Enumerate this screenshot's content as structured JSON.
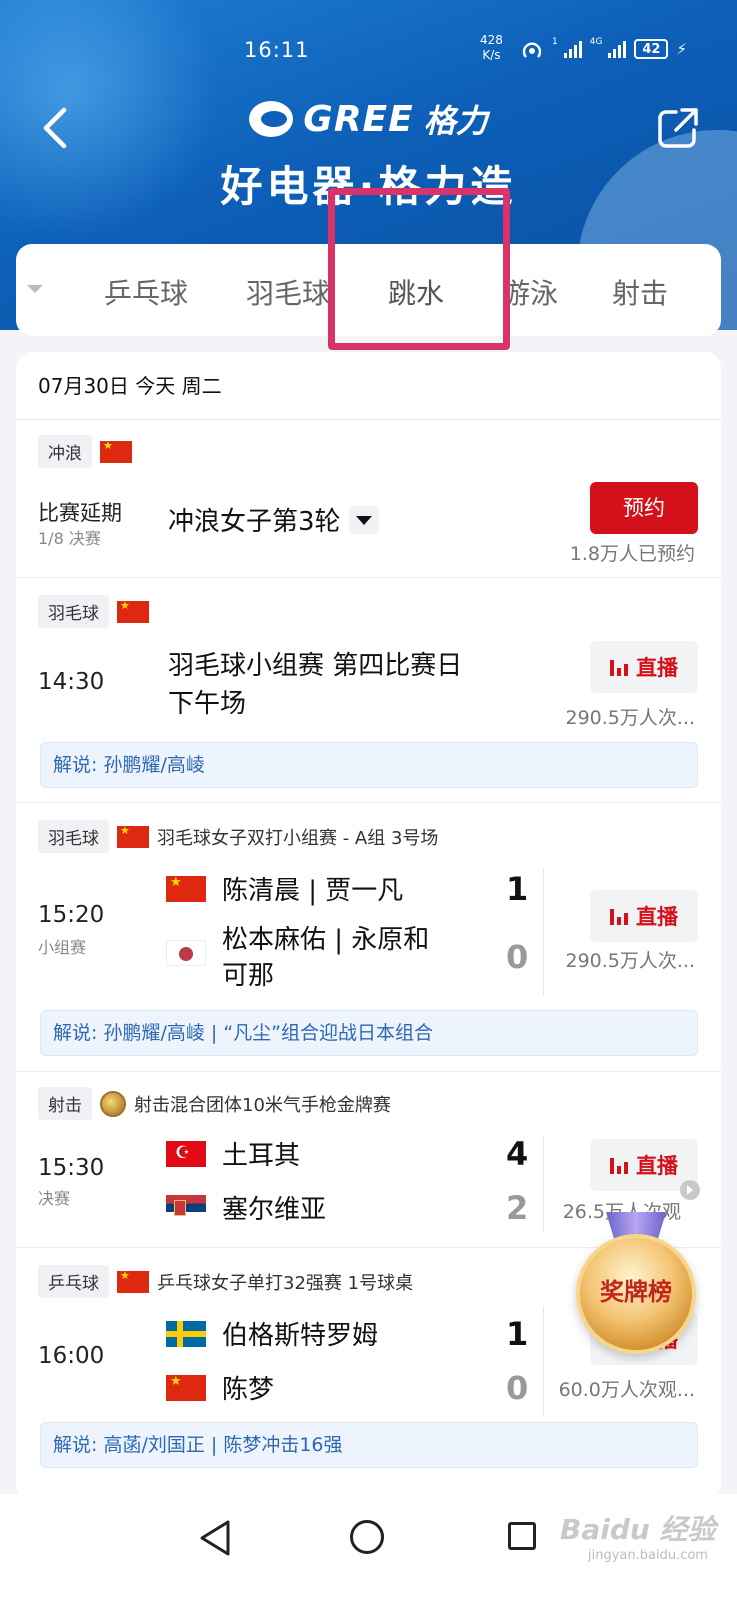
{
  "status_bar": {
    "time": "16:11",
    "speed_value": "428",
    "speed_unit": "K/s",
    "battery": "42"
  },
  "header": {
    "brand": "GREE",
    "brand_cn": "格力",
    "slogan": "好电器·格力造"
  },
  "tabs": [
    {
      "label": "乒乓球"
    },
    {
      "label": "羽毛球"
    },
    {
      "label": "跳水",
      "active": true
    },
    {
      "label": "游泳"
    },
    {
      "label": "射击"
    }
  ],
  "schedule": {
    "date": "07月30日 今天 周二",
    "events": [
      {
        "sport": "冲浪",
        "status": "比赛延期",
        "round": "1/8 决赛",
        "title": "冲浪女子第3轮",
        "button": "预约",
        "count": "1.8万人已预约"
      },
      {
        "sport": "羽毛球",
        "time": "14:30",
        "title_line1": "羽毛球小组赛 第四比赛日",
        "title_line2": "下午场",
        "button": "直播",
        "count": "290.5万人次...",
        "commentary": "解说: 孙鹏耀/高崚"
      },
      {
        "sport": "羽毛球",
        "event_name": "羽毛球女子双打小组赛 - A组 3号场",
        "time": "15:20",
        "stage": "小组赛",
        "team1": "陈清晨 | 贾一凡",
        "score1": "1",
        "team2_line1": "松本麻佑 | 永原和",
        "team2_line2": "可那",
        "score2": "0",
        "button": "直播",
        "count": "290.5万人次...",
        "commentary": "解说: 孙鹏耀/高崚 | “凡尘”组合迎战日本组合"
      },
      {
        "sport": "射击",
        "event_name": "射击混合团体10米气手枪金牌赛",
        "time": "15:30",
        "stage": "决赛",
        "team1": "土耳其",
        "score1": "4",
        "team2": "塞尔维亚",
        "score2": "2",
        "button": "直播",
        "count": "26.5万人次观"
      },
      {
        "sport": "乒乓球",
        "event_name": "乒乓球女子单打32强赛 1号球桌",
        "time": "16:00",
        "team1": "伯格斯特罗姆",
        "score1": "1",
        "team2": "陈梦",
        "score2": "0",
        "button": "直播",
        "count": "60.0万人次观...",
        "commentary": "解说: 高菡/刘国正 | 陈梦冲击16强"
      }
    ]
  },
  "medal_badge": {
    "label": "奖牌榜"
  },
  "watermark": {
    "text": "Baidu 经验",
    "sub": "jingyan.baidu.com"
  },
  "colors": {
    "header_blue": "#0d5fb8",
    "accent_red": "#d4111b",
    "highlight_pink": "#d9336a",
    "commentary_blue": "#2e68b3"
  }
}
